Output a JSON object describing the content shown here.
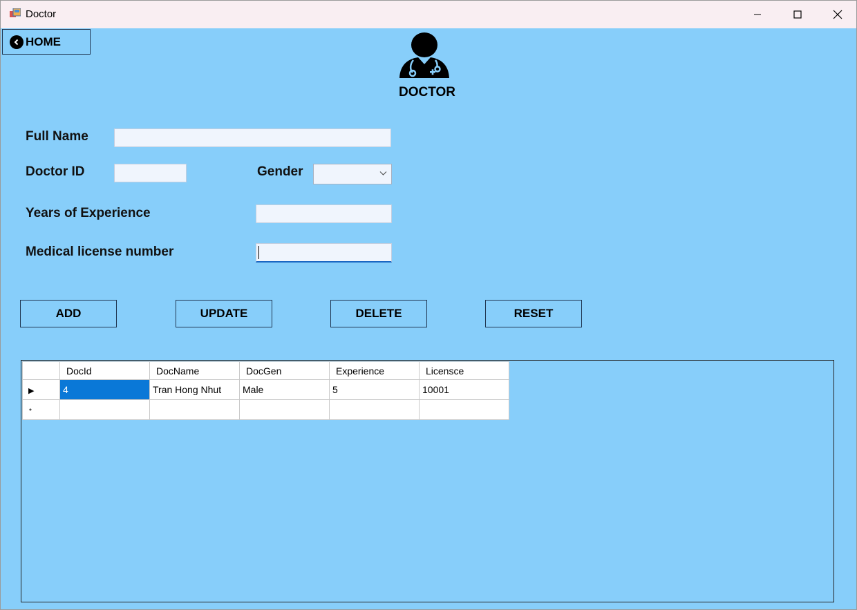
{
  "window": {
    "title": "Doctor",
    "controls": [
      "minimize",
      "maximize",
      "close"
    ]
  },
  "nav": {
    "home_label": "HOME"
  },
  "header": {
    "title": "DOCTOR",
    "icon": "doctor-icon"
  },
  "form": {
    "full_name": {
      "label": "Full Name",
      "value": ""
    },
    "doctor_id": {
      "label": "Doctor ID",
      "value": ""
    },
    "gender": {
      "label": "Gender",
      "selected": ""
    },
    "experience": {
      "label": "Years of Experience",
      "value": ""
    },
    "license": {
      "label": "Medical license number",
      "value": ""
    }
  },
  "actions": {
    "add": "ADD",
    "update": "UPDATE",
    "delete": "DELETE",
    "reset": "RESET"
  },
  "grid": {
    "columns": [
      "DocId",
      "DocName",
      "DocGen",
      "Experience",
      "Licensce"
    ],
    "rows": [
      [
        "4",
        "Tran Hong Nhut",
        "Male",
        "5",
        "10001"
      ]
    ],
    "new_row_marker": "*",
    "current_row_marker": "▶"
  },
  "colors": {
    "background": "#87cefa",
    "selection": "#0a78d7",
    "titlebar": "#f9eef2"
  }
}
